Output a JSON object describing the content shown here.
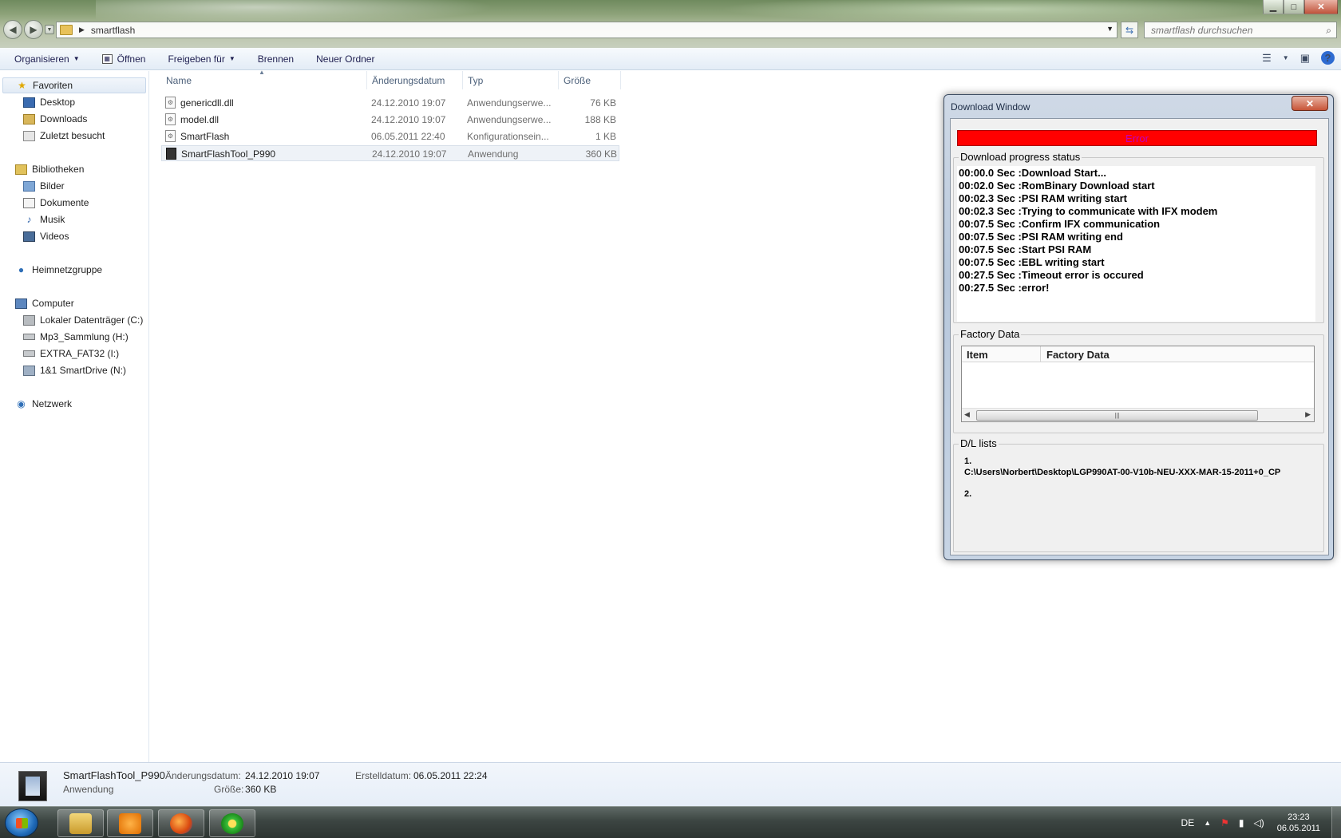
{
  "window": {
    "controls": {
      "minimize": "▁",
      "maximize": "□",
      "close": "✕"
    }
  },
  "address": {
    "crumb": "smartflash",
    "search_placeholder": "smartflash durchsuchen"
  },
  "toolbar": {
    "organize": "Organisieren",
    "open": "Öffnen",
    "share": "Freigeben für",
    "burn": "Brennen",
    "new_folder": "Neuer Ordner",
    "help": "?"
  },
  "nav": {
    "favorites": "Favoriten",
    "desktop": "Desktop",
    "downloads": "Downloads",
    "recent": "Zuletzt besucht",
    "libraries": "Bibliotheken",
    "pictures": "Bilder",
    "documents": "Dokumente",
    "music": "Musik",
    "videos": "Videos",
    "homegroup": "Heimnetzgruppe",
    "computer": "Computer",
    "drive_c": "Lokaler Datenträger (C:)",
    "drive_h": "Mp3_Sammlung (H:)",
    "drive_i": "EXTRA_FAT32 (I:)",
    "drive_n": "1&1 SmartDrive (N:)",
    "network": "Netzwerk"
  },
  "columns": {
    "name": "Name",
    "date": "Änderungsdatum",
    "type": "Typ",
    "size": "Größe"
  },
  "files": [
    {
      "name": "genericdll.dll",
      "date": "24.12.2010 19:07",
      "type": "Anwendungserwe...",
      "size": "76 KB"
    },
    {
      "name": "model.dll",
      "date": "24.12.2010 19:07",
      "type": "Anwendungserwe...",
      "size": "188 KB"
    },
    {
      "name": "SmartFlash",
      "date": "06.05.2011 22:40",
      "type": "Konfigurationsein...",
      "size": "1 KB"
    },
    {
      "name": "SmartFlashTool_P990",
      "date": "24.12.2010 19:07",
      "type": "Anwendung",
      "size": "360 KB"
    }
  ],
  "details": {
    "name": "SmartFlashTool_P990",
    "kind": "Anwendung",
    "modified_label": "Änderungsdatum:",
    "modified": "24.12.2010 19:07",
    "size_label": "Größe:",
    "size": "360 KB",
    "created_label": "Erstelldatum:",
    "created": "06.05.2011 22:24"
  },
  "download_window": {
    "title": "Download Window",
    "close": "✕",
    "status": "Error",
    "progress_label": "Download progress status",
    "log": [
      "00:00.0 Sec  :Download Start...",
      "00:02.0 Sec  :RomBinary Download start",
      "00:02.3 Sec  :PSI RAM writing start",
      "00:02.3 Sec  :Trying to communicate with IFX modem",
      "00:07.5 Sec  :Confirm IFX communication",
      "00:07.5 Sec  :PSI RAM writing end",
      "00:07.5 Sec  :Start PSI RAM",
      "00:07.5 Sec  :EBL writing start",
      "00:27.5 Sec  :Timeout error is occured",
      "00:27.5 Sec  :error!"
    ],
    "factory_label": "Factory Data",
    "factory_cols": {
      "item": "Item",
      "data": "Factory Data"
    },
    "dl_label": "D/L lists",
    "dl_items": [
      {
        "num": "1.",
        "path": "C:\\Users\\Norbert\\Desktop\\LGP990AT-00-V10b-NEU-XXX-MAR-15-2011+0_CP"
      },
      {
        "num": "2.",
        "path": ""
      }
    ]
  },
  "taskbar": {
    "lang": "DE",
    "time": "23:23",
    "date": "06.05.2011"
  },
  "colors": {
    "error_bar": "#ff0000",
    "error_text": "#c000c0",
    "selection": "#eef2f7"
  }
}
